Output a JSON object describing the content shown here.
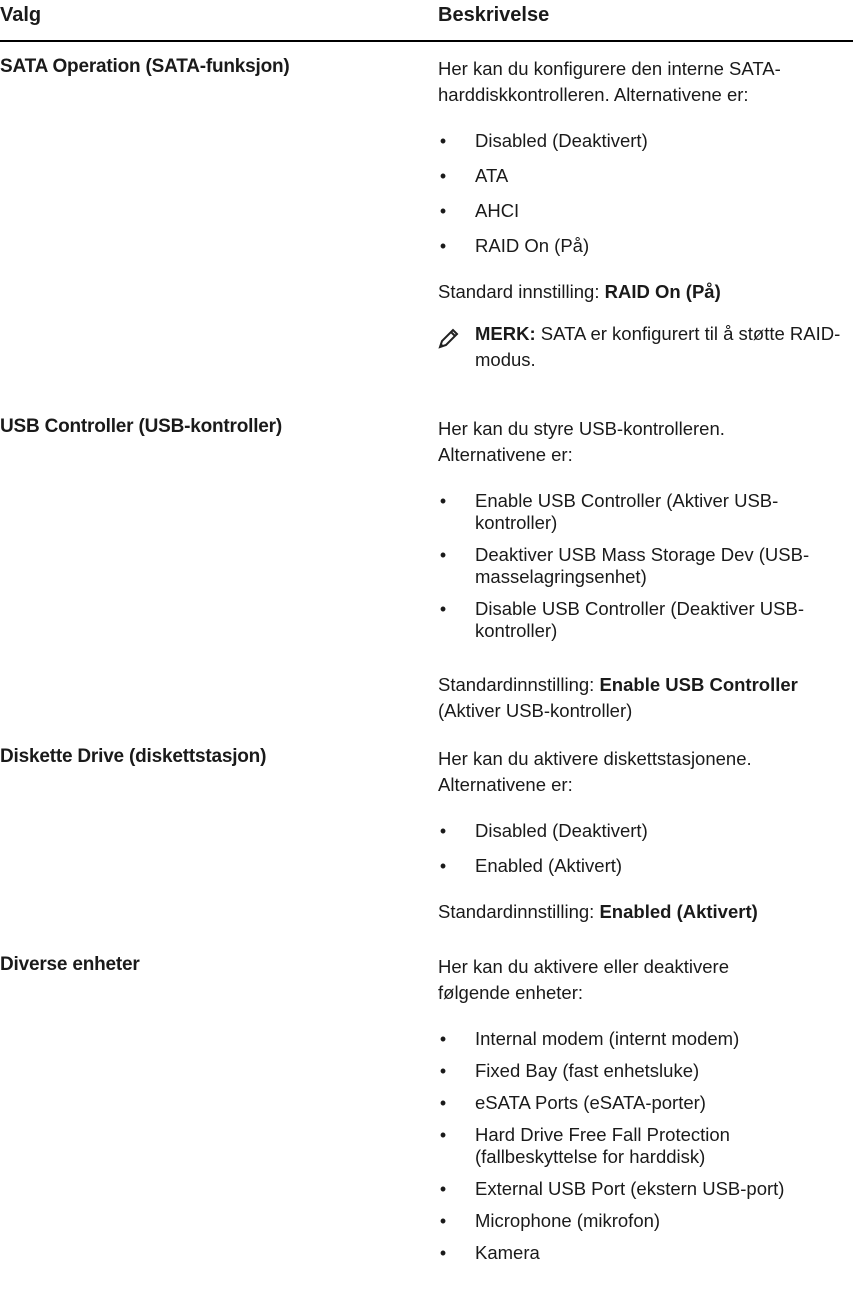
{
  "header": {
    "col_option": "Valg",
    "col_description": "Beskrivelse"
  },
  "rows": [
    {
      "option": "SATA Operation (SATA-funksjon)",
      "intro": "Her kan du konfigurere den interne SATA-harddiskkontrolleren. Alternativene er:",
      "items": [
        "Disabled (Deaktivert)",
        "ATA",
        "AHCI",
        "RAID On (På)"
      ],
      "default_label": "Standard innstilling: ",
      "default_value": "RAID On (På)",
      "note_label": "MERK:",
      "note_text": " SATA er konfigurert til å støtte RAID-modus."
    },
    {
      "option": "USB Controller (USB-kontroller)",
      "intro": "Her kan du styre USB-kontrolleren. Alternativene er:",
      "items": [
        "Enable USB Controller (Aktiver USB-kontroller)",
        "Deaktiver USB Mass Storage Dev (USB-masselagringsenhet)",
        "Disable USB Controller (Deaktiver USB-kontroller)"
      ],
      "default_label": "Standardinnstilling: ",
      "default_value": "Enable USB Controller",
      "default_suffix": " (Aktiver USB-kontroller)"
    },
    {
      "option": "Diskette Drive (diskettstasjon)",
      "intro": "Her kan du aktivere diskettstasjonene. Alternativene er:",
      "items": [
        "Disabled (Deaktivert)",
        "Enabled (Aktivert)"
      ],
      "default_label": "Standardinnstilling: ",
      "default_value": "Enabled (Aktivert)"
    },
    {
      "option": "Diverse enheter",
      "intro": "Her kan du aktivere eller deaktivere følgende enheter:",
      "items": [
        "Internal modem (internt modem)",
        "Fixed Bay (fast enhetsluke)",
        "eSATA Ports (eSATA-porter)",
        "Hard Drive Free Fall Protection (fallbeskyttelse for harddisk)",
        "External USB Port (ekstern USB-port)",
        "Microphone (mikrofon)",
        "Kamera"
      ]
    }
  ],
  "icons": {
    "bullet": "bullet-dot",
    "note": "pencil-note-icon"
  }
}
